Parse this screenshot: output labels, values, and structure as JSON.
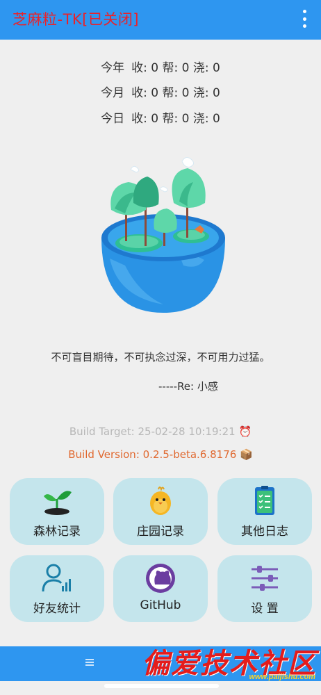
{
  "app": {
    "title": "芝麻粒-TK[已关闭]",
    "menu_icon": "more-vertical-icon"
  },
  "stats": [
    {
      "label": "今年",
      "values": "收: 0 帮: 0 浇: 0"
    },
    {
      "label": "今月",
      "values": "收: 0 帮: 0 浇: 0"
    },
    {
      "label": "今日",
      "values": "收: 0 帮: 0 浇: 0"
    }
  ],
  "illustration": "forest-bowl-image",
  "quote": {
    "text": "不可盲目期待，不可执念过深，不可用力过猛。",
    "author": "-----Re: 小感"
  },
  "build": {
    "target": "Build Target: 25-02-28 10:19:21 ⏰",
    "version": "Build Version: 0.2.5-beta.6.8176 📦"
  },
  "tiles": [
    {
      "label": "森林记录",
      "icon": "sprout-icon"
    },
    {
      "label": "庄园记录",
      "icon": "chick-icon"
    },
    {
      "label": "其他日志",
      "icon": "checklist-icon"
    },
    {
      "label": "好友统计",
      "icon": "user-stats-icon"
    },
    {
      "label": "GitHub",
      "icon": "github-icon"
    },
    {
      "label": "设 置",
      "icon": "sliders-icon"
    }
  ],
  "bottom_bar": {
    "icon": "hamburger-icon"
  },
  "watermark": {
    "text": "偏爱技术社区",
    "url": "www.paijishu.com"
  },
  "colors": {
    "appbar": "#2e96f0",
    "title": "#e8232b",
    "tile_bg": "#c4e5ec",
    "build_version": "#e0682f"
  }
}
